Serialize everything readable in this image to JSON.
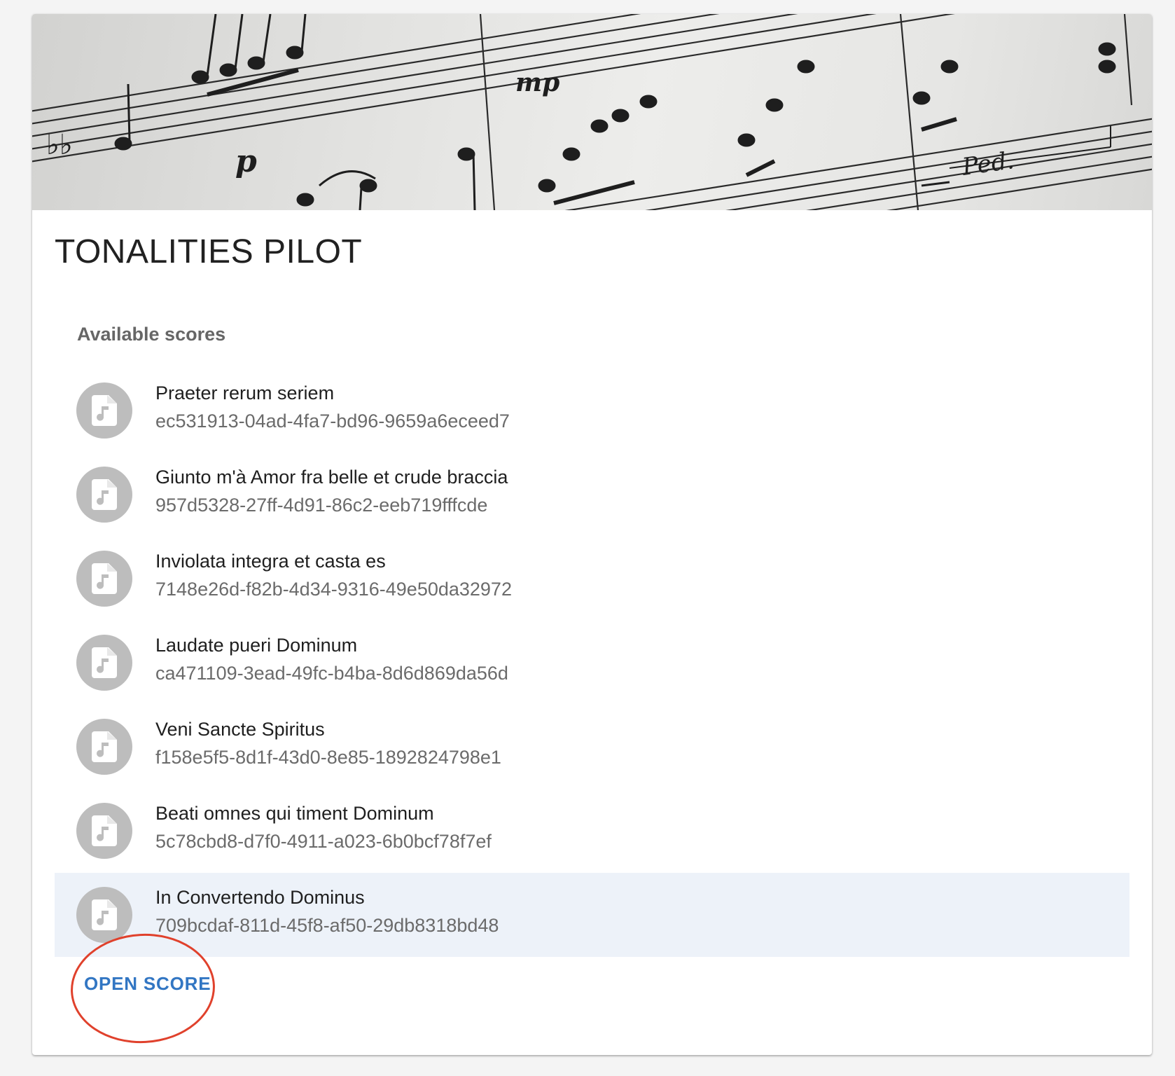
{
  "project": {
    "title": "TONALITIES PILOT",
    "banner_image": "sheet-music-banner"
  },
  "scores": {
    "header": "Available scores",
    "icon": "music-file-icon",
    "items": [
      {
        "title": "Praeter rerum seriem",
        "id": "ec531913-04ad-4fa7-bd96-9659a6eceed7",
        "selected": false
      },
      {
        "title": "Giunto m'à Amor fra belle et crude braccia",
        "id": "957d5328-27ff-4d91-86c2-eeb719fffcde",
        "selected": false
      },
      {
        "title": "Inviolata integra et casta es",
        "id": "7148e26d-f82b-4d34-9316-49e50da32972",
        "selected": false
      },
      {
        "title": "Laudate pueri Dominum",
        "id": "ca471109-3ead-49fc-b4ba-8d6d869da56d",
        "selected": false
      },
      {
        "title": "Veni Sancte Spiritus",
        "id": "f158e5f5-8d1f-43d0-8e85-1892824798e1",
        "selected": false
      },
      {
        "title": "Beati omnes qui timent Dominum",
        "id": "5c78cbd8-d7f0-4911-a023-6b0bcf78f7ef",
        "selected": false
      },
      {
        "title": "In Convertendo Dominus",
        "id": "709bcdaf-811d-45f8-af50-29db8318bd48",
        "selected": true
      }
    ]
  },
  "actions": {
    "open_label": "OPEN SCORE"
  },
  "colors": {
    "accent": "#3276c3",
    "selected_row": "#edf2f9",
    "avatar": "#bdbdbd",
    "annotation": "#e0412c"
  }
}
